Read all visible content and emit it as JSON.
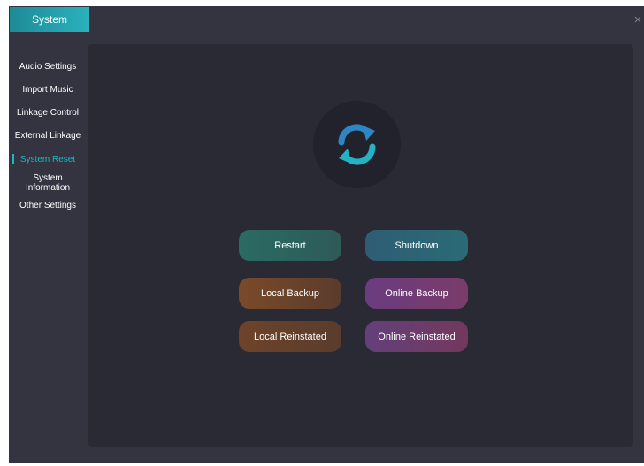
{
  "window": {
    "title": "System",
    "close_glyph": "×"
  },
  "sidebar": {
    "items": [
      {
        "label": "Audio Settings",
        "active": false
      },
      {
        "label": "Import Music",
        "active": false
      },
      {
        "label": "Linkage Control",
        "active": false
      },
      {
        "label": "External Linkage",
        "active": false
      },
      {
        "label": "System Reset",
        "active": true
      },
      {
        "label": "System Information",
        "active": false
      },
      {
        "label": "Other Settings",
        "active": false
      }
    ]
  },
  "main": {
    "icon": "refresh-icon",
    "buttons": {
      "restart": "Restart",
      "shutdown": "Shutdown",
      "local_backup": "Local Backup",
      "online_backup": "Online Backup",
      "local_reinstated": "Local Reinstated",
      "online_reinstated": "Online Reinstated"
    }
  },
  "colors": {
    "accent": "#1fb5c4",
    "background": "#343441",
    "panel": "#2a2a35"
  }
}
